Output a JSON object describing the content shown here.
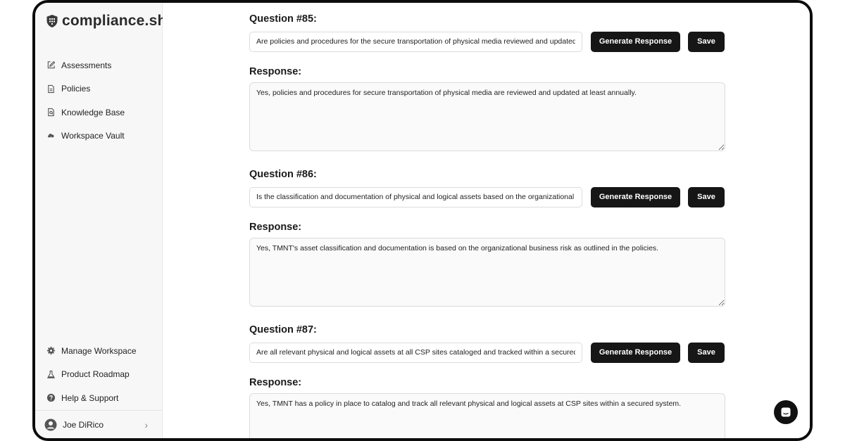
{
  "brand": {
    "name": "compliance.sh"
  },
  "sidebar": {
    "top_items": [
      {
        "label": "Assessments",
        "icon": "edit-icon"
      },
      {
        "label": "Policies",
        "icon": "document-icon"
      },
      {
        "label": "Knowledge Base",
        "icon": "knowledge-icon"
      },
      {
        "label": "Workspace Vault",
        "icon": "vault-icon"
      }
    ],
    "bottom_items": [
      {
        "label": "Manage Workspace",
        "icon": "gear-icon"
      },
      {
        "label": "Product Roadmap",
        "icon": "flask-icon"
      },
      {
        "label": "Help & Support",
        "icon": "help-icon"
      }
    ],
    "user": {
      "name": "Joe DiRico"
    }
  },
  "questions": [
    {
      "label": "Question #85:",
      "question": "Are policies and procedures for the secure transportation of physical media reviewed and updated at least annually?",
      "response_label": "Response:",
      "response": "Yes, policies and procedures for secure transportation of physical media are reviewed and updated at least annually."
    },
    {
      "label": "Question #86:",
      "question": "Is the classification and documentation of physical and logical assets based on the organizational business risk?",
      "response_label": "Response:",
      "response": "Yes, TMNT's asset classification and documentation is based on the organizational business risk as outlined in the policies."
    },
    {
      "label": "Question #87:",
      "question": "Are all relevant physical and logical assets at all CSP sites cataloged and tracked within a secured system?",
      "response_label": "Response:",
      "response": "Yes, TMNT has a policy in place to catalog and track all relevant physical and logical assets at CSP sites within a secured system."
    }
  ],
  "buttons": {
    "generate": "Generate Response",
    "save": "Save"
  },
  "colors": {
    "button_bg": "#161616",
    "sidebar_bg": "#f7f7f7",
    "frame_border": "#0c0c0c"
  }
}
